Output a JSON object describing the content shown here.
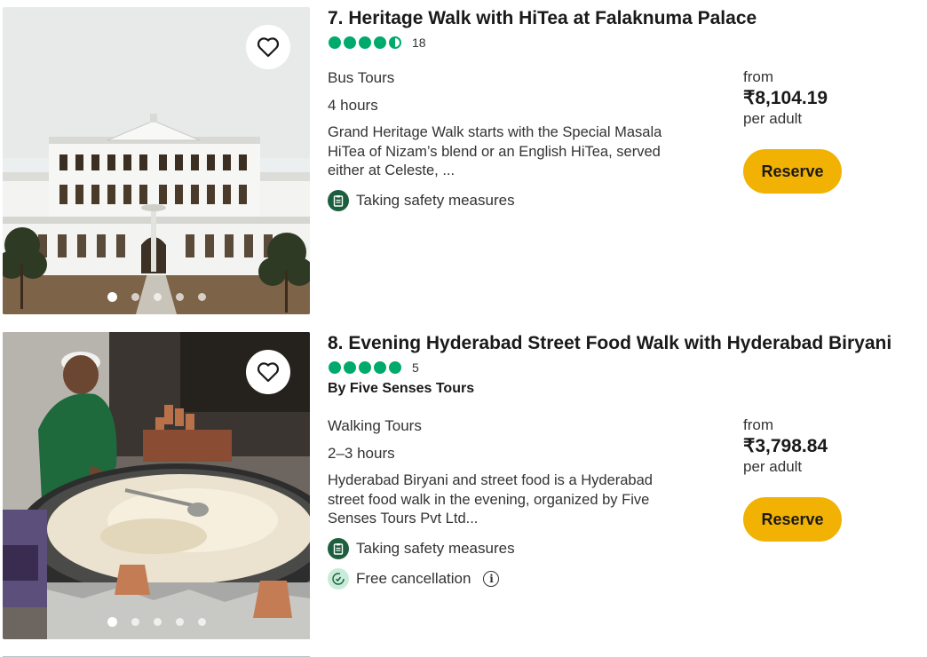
{
  "listings": [
    {
      "title": "7. Heritage Walk with HiTea at Falaknuma Palace",
      "rating": 4.5,
      "review_count": "18",
      "by": "",
      "category": "Bus Tours",
      "duration": "4 hours",
      "description_lines": [
        "Grand Heritage Walk starts with the Special Masala",
        "HiTea of Nizam’s blend or an English HiTea, served",
        "either at Celeste, ..."
      ],
      "features": [
        "Taking safety measures"
      ],
      "price_from": "from",
      "price": "₹8,104.19",
      "price_unit": "per adult",
      "reserve_label": "Reserve",
      "carousel_count": 5,
      "carousel_active": 1
    },
    {
      "title": "8. Evening Hyderabad Street Food Walk with Hyderabad Biryani",
      "rating": 5,
      "review_count": "5",
      "by": "By Five Senses Tours",
      "category": "Walking Tours",
      "duration": "2–3 hours",
      "description_lines": [
        "Hyderabad Biryani and street food is a Hyderabad",
        "street food walk in the evening, organized by Five",
        "Senses Tours Pvt Ltd..."
      ],
      "features": [
        "Taking safety measures",
        "Free cancellation"
      ],
      "price_from": "from",
      "price": "₹3,798.84",
      "price_unit": "per adult",
      "reserve_label": "Reserve",
      "carousel_count": 5,
      "carousel_active": 1
    }
  ],
  "icons": {
    "heart": "heart-outline-icon",
    "safety": "clipboard-icon",
    "cancel": "cancel-clock-icon",
    "info": "info-icon"
  },
  "colors": {
    "rating_green": "#00aa6c",
    "reserve_yellow": "#f2b203",
    "safety_green": "#1d5e3e",
    "cancel_green_light": "#c8ecd9"
  }
}
